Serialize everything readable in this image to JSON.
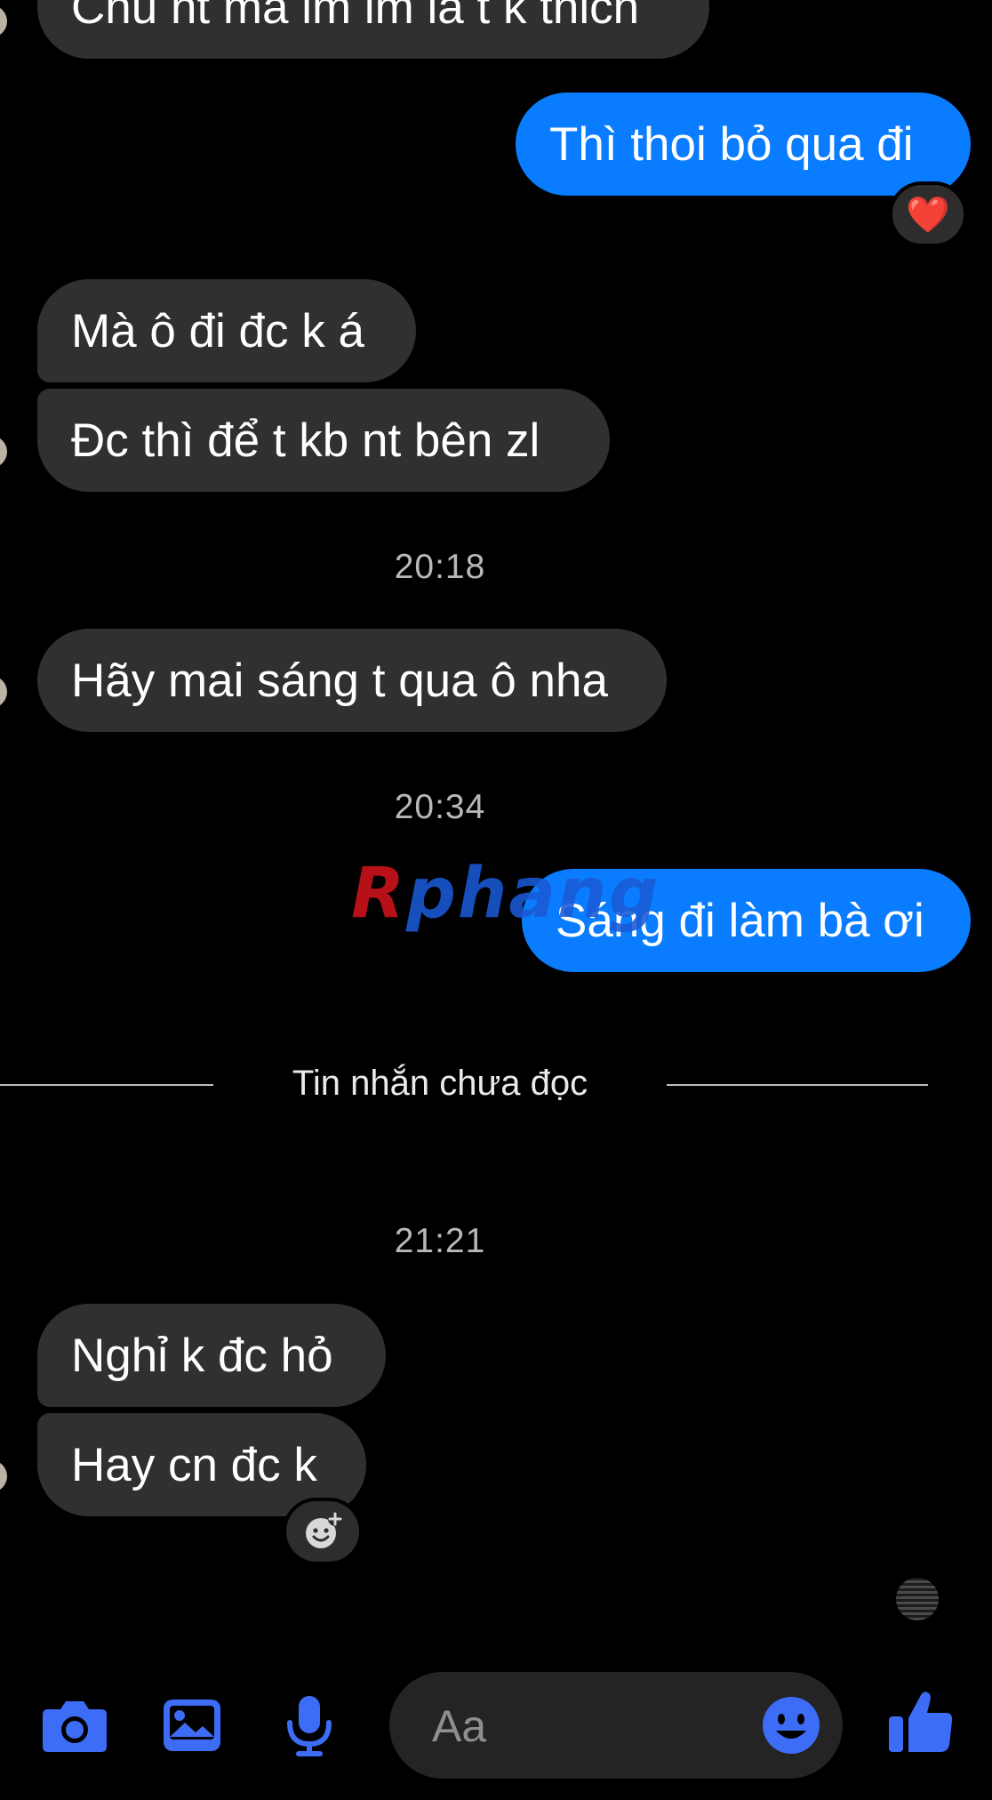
{
  "colors": {
    "background": "#000000",
    "incoming_bubble": "#303030",
    "outgoing_bubble": "#0a7cff",
    "accent": "#3d6cf6",
    "timestamp_text": "#b8b8b8"
  },
  "messages": {
    "m1": "Chu nt ma im im la t k thich",
    "m2": "Thì thoi bỏ qua đi",
    "m2_reaction": "❤️",
    "m3": "Mà ô đi đc k á",
    "m4": "Đc thì để t kb nt bên zl",
    "m5": "Hãy mai sáng t qua ô nha",
    "m6": "Sáng đi làm bà ơi",
    "m7": "Nghỉ k đc hỏ",
    "m8": "Hay cn đc k"
  },
  "timestamps": {
    "t1": "20:18",
    "t2": "20:34",
    "t3": "21:21"
  },
  "unread_divider": "Tin nhắn chưa đọc",
  "watermark": {
    "first": "R",
    "rest": "phang"
  },
  "composer": {
    "placeholder": "Aa"
  },
  "toolbar": {
    "icons": [
      "camera-icon",
      "gallery-icon",
      "microphone-icon",
      "emoji-icon",
      "thumbs-up-icon"
    ]
  }
}
